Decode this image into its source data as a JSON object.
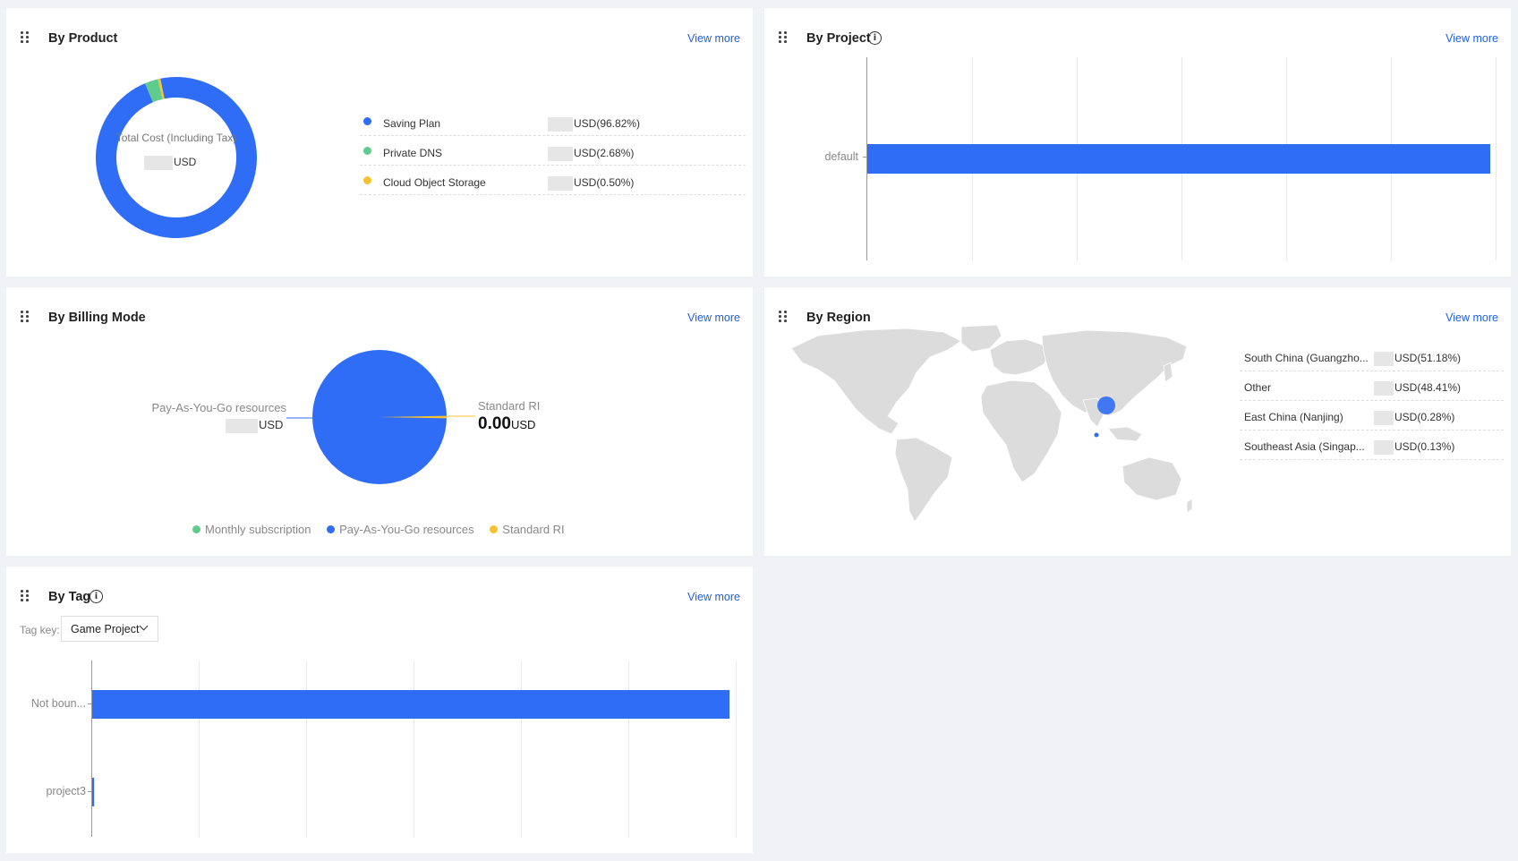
{
  "by_product": {
    "title": "By Product",
    "view_more": "View more",
    "donut_label": "Total Cost (Including Tax)",
    "donut_value_suffix": "USD",
    "items": [
      {
        "label": "Saving Plan",
        "value": "USD(96.82%)",
        "color": "#2f6df6",
        "percent": 96.82
      },
      {
        "label": "Private DNS",
        "value": "USD(2.68%)",
        "color": "#5fcc8e",
        "percent": 2.68
      },
      {
        "label": "Cloud Object Storage",
        "value": "USD(0.50%)",
        "color": "#f7c230",
        "percent": 0.5
      }
    ]
  },
  "by_project": {
    "title": "By Project",
    "view_more": "View more",
    "bars": [
      {
        "label": "default",
        "share": 1.0
      }
    ]
  },
  "by_billing_mode": {
    "title": "By Billing Mode",
    "view_more": "View more",
    "left_label": "Pay-As-You-Go resources",
    "left_value_suffix": "USD",
    "right_label": "Standard RI",
    "right_value": "0.00",
    "right_value_suffix": "USD",
    "legend": [
      {
        "label": "Monthly subscription",
        "color": "#5fcc8e"
      },
      {
        "label": "Pay-As-You-Go resources",
        "color": "#2f6df6"
      },
      {
        "label": "Standard RI",
        "color": "#f7c230"
      }
    ]
  },
  "by_region": {
    "title": "By Region",
    "view_more": "View more",
    "items": [
      {
        "label": "South China (Guangzho...",
        "value": "USD(51.18%)"
      },
      {
        "label": "Other",
        "value": "USD(48.41%)"
      },
      {
        "label": "East China (Nanjing)",
        "value": "USD(0.28%)"
      },
      {
        "label": "Southeast Asia (Singap...",
        "value": "USD(0.13%)"
      }
    ]
  },
  "by_tag": {
    "title": "By Tag",
    "view_more": "View more",
    "tag_key_label": "Tag key:",
    "tag_key_value": "Game Project",
    "bars": [
      {
        "label": "Not boun...",
        "share": 1.0
      },
      {
        "label": "project3",
        "share": 0.003
      }
    ]
  },
  "colors": {
    "accent": "#2f6df6",
    "link": "#2060e0"
  }
}
